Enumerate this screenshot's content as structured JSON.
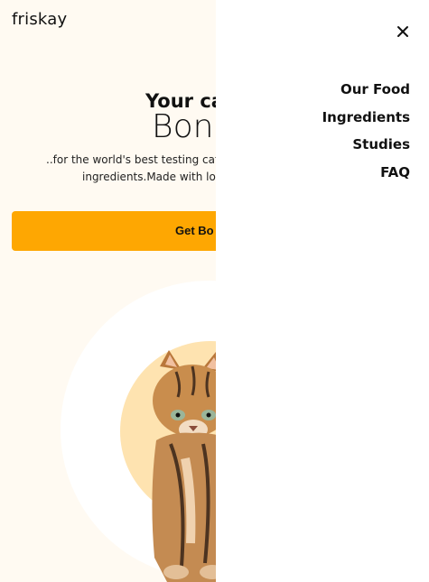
{
  "brand": {
    "logo_text": "friskay"
  },
  "hero": {
    "title": "Your cat",
    "product": "Bonk",
    "desc_line1": "..for the world's best testing cat fo",
    "desc_line2": "ingredients.Made with lov",
    "cta_label": "Get Bo"
  },
  "menu": {
    "close_icon": "close-icon",
    "items": [
      {
        "label": "Our Food"
      },
      {
        "label": "Ingredients"
      },
      {
        "label": "Studies"
      },
      {
        "label": "FAQ"
      }
    ]
  },
  "colors": {
    "background": "#fffaf2",
    "accent": "#fea702",
    "circle_outer": "#ffffff",
    "circle_inner": "#fee3b0",
    "menu_bg": "#ffffff"
  },
  "images": {
    "hero_image": "kitten-photo"
  }
}
